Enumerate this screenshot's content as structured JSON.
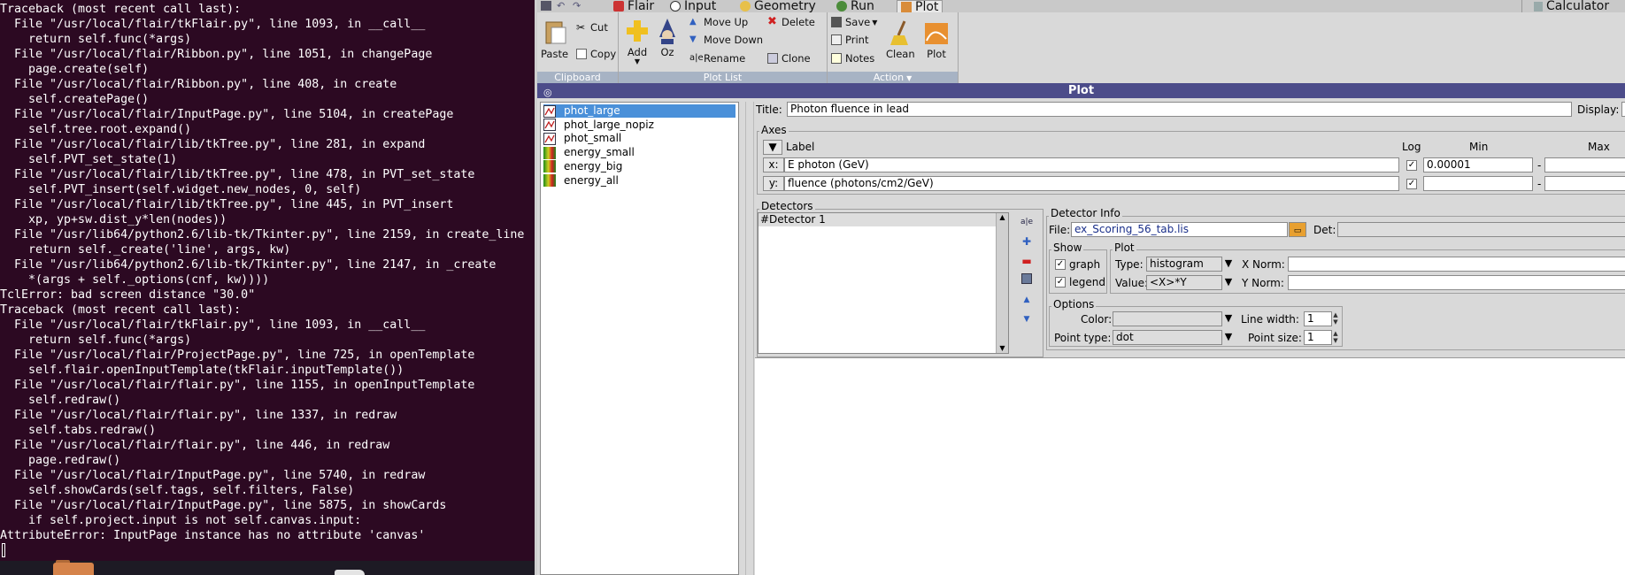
{
  "terminal": {
    "lines": [
      "Traceback (most recent call last):",
      "  File \"/usr/local/flair/tkFlair.py\", line 1093, in __call__",
      "    return self.func(*args)",
      "  File \"/usr/local/flair/Ribbon.py\", line 1051, in changePage",
      "    page.create(self)",
      "  File \"/usr/local/flair/Ribbon.py\", line 408, in create",
      "    self.createPage()",
      "  File \"/usr/local/flair/InputPage.py\", line 5104, in createPage",
      "    self.tree.root.expand()",
      "  File \"/usr/local/flair/lib/tkTree.py\", line 281, in expand",
      "    self.PVT_set_state(1)",
      "  File \"/usr/local/flair/lib/tkTree.py\", line 478, in PVT_set_state",
      "    self.PVT_insert(self.widget.new_nodes, 0, self)",
      "  File \"/usr/local/flair/lib/tkTree.py\", line 445, in PVT_insert",
      "    xp, yp+sw.dist_y*len(nodes))",
      "  File \"/usr/lib64/python2.6/lib-tk/Tkinter.py\", line 2159, in create_line",
      "    return self._create('line', args, kw)",
      "  File \"/usr/lib64/python2.6/lib-tk/Tkinter.py\", line 2147, in _create",
      "    *(args + self._options(cnf, kw))))",
      "TclError: bad screen distance \"30.0\"",
      "Traceback (most recent call last):",
      "  File \"/usr/local/flair/tkFlair.py\", line 1093, in __call__",
      "    return self.func(*args)",
      "  File \"/usr/local/flair/ProjectPage.py\", line 725, in openTemplate",
      "    self.flair.openInputTemplate(tkFlair.inputTemplate())",
      "  File \"/usr/local/flair/flair.py\", line 1155, in openInputTemplate",
      "    self.redraw()",
      "  File \"/usr/local/flair/flair.py\", line 1337, in redraw",
      "    self.tabs.redraw()",
      "  File \"/usr/local/flair/flair.py\", line 446, in redraw",
      "    page.redraw()",
      "  File \"/usr/local/flair/InputPage.py\", line 5740, in redraw",
      "    self.showCards(self.tags, self.filters, False)",
      "  File \"/usr/local/flair/InputPage.py\", line 5875, in showCards",
      "    if self.project.input is not self.canvas.input:",
      "AttributeError: InputPage instance has no attribute 'canvas'"
    ]
  },
  "tabs": {
    "flair": "Flair",
    "input": "Input",
    "geometry": "Geometry",
    "run": "Run",
    "plot": "Plot",
    "calculator": "Calculator"
  },
  "ribbon": {
    "clipboard": {
      "label": "Clipboard",
      "paste": "Paste",
      "cut": "Cut",
      "copy": "Copy"
    },
    "plotlist": {
      "label": "Plot List",
      "add": "Add",
      "oz": "Oz",
      "move_up": "Move Up",
      "move_down": "Move Down",
      "rename": "Rename",
      "delete": "Delete",
      "clone": "Clone"
    },
    "action": {
      "label": "Action",
      "save": "Save",
      "print": "Print",
      "notes": "Notes",
      "clean": "Clean",
      "plot": "Plot"
    }
  },
  "window_title": "Plot",
  "plot_list": [
    "phot_large",
    "phot_large_nopiz",
    "phot_small",
    "energy_small",
    "energy_big",
    "energy_all"
  ],
  "panel": {
    "title_label": "Title:",
    "title_value": "Photon fluence in lead",
    "display_label": "Display:",
    "axes": {
      "frame": "Axes",
      "label_header": "Label",
      "log_header": "Log",
      "min_header": "Min",
      "max_header": "Max",
      "x_btn": "x:",
      "y_btn": "y:",
      "x_label": "E photon (GeV)",
      "y_label": "fluence (photons/cm2/GeV)",
      "x_min": "0.00001",
      "dash": "-"
    },
    "detectors": {
      "frame": "Detectors",
      "items": [
        "#Detector 1"
      ]
    },
    "detinfo": {
      "frame": "Detector Info",
      "file_label": "File:",
      "file_value": "ex_Scoring_56_tab.lis",
      "det_label": "Det:",
      "show_frame": "Show",
      "graph": "graph",
      "legend": "legend",
      "plot_frame": "Plot",
      "type_label": "Type:",
      "type_value": "histogram",
      "value_label": "Value:",
      "value_value": "<X>*Y",
      "xnorm_label": "X Norm:",
      "ynorm_label": "Y Norm:",
      "options_frame": "Options",
      "color_label": "Color:",
      "linewidth_label": "Line width:",
      "linewidth_value": "1",
      "pointtype_label": "Point type:",
      "pointtype_value": "dot",
      "pointsize_label": "Point size:",
      "pointsize_value": "1"
    }
  },
  "colors": {
    "terminal_bg": "#2c0922",
    "titlebar": "#4c4c8a",
    "ribbon_label": "#a7b3c4",
    "selection": "#4a90d9"
  }
}
